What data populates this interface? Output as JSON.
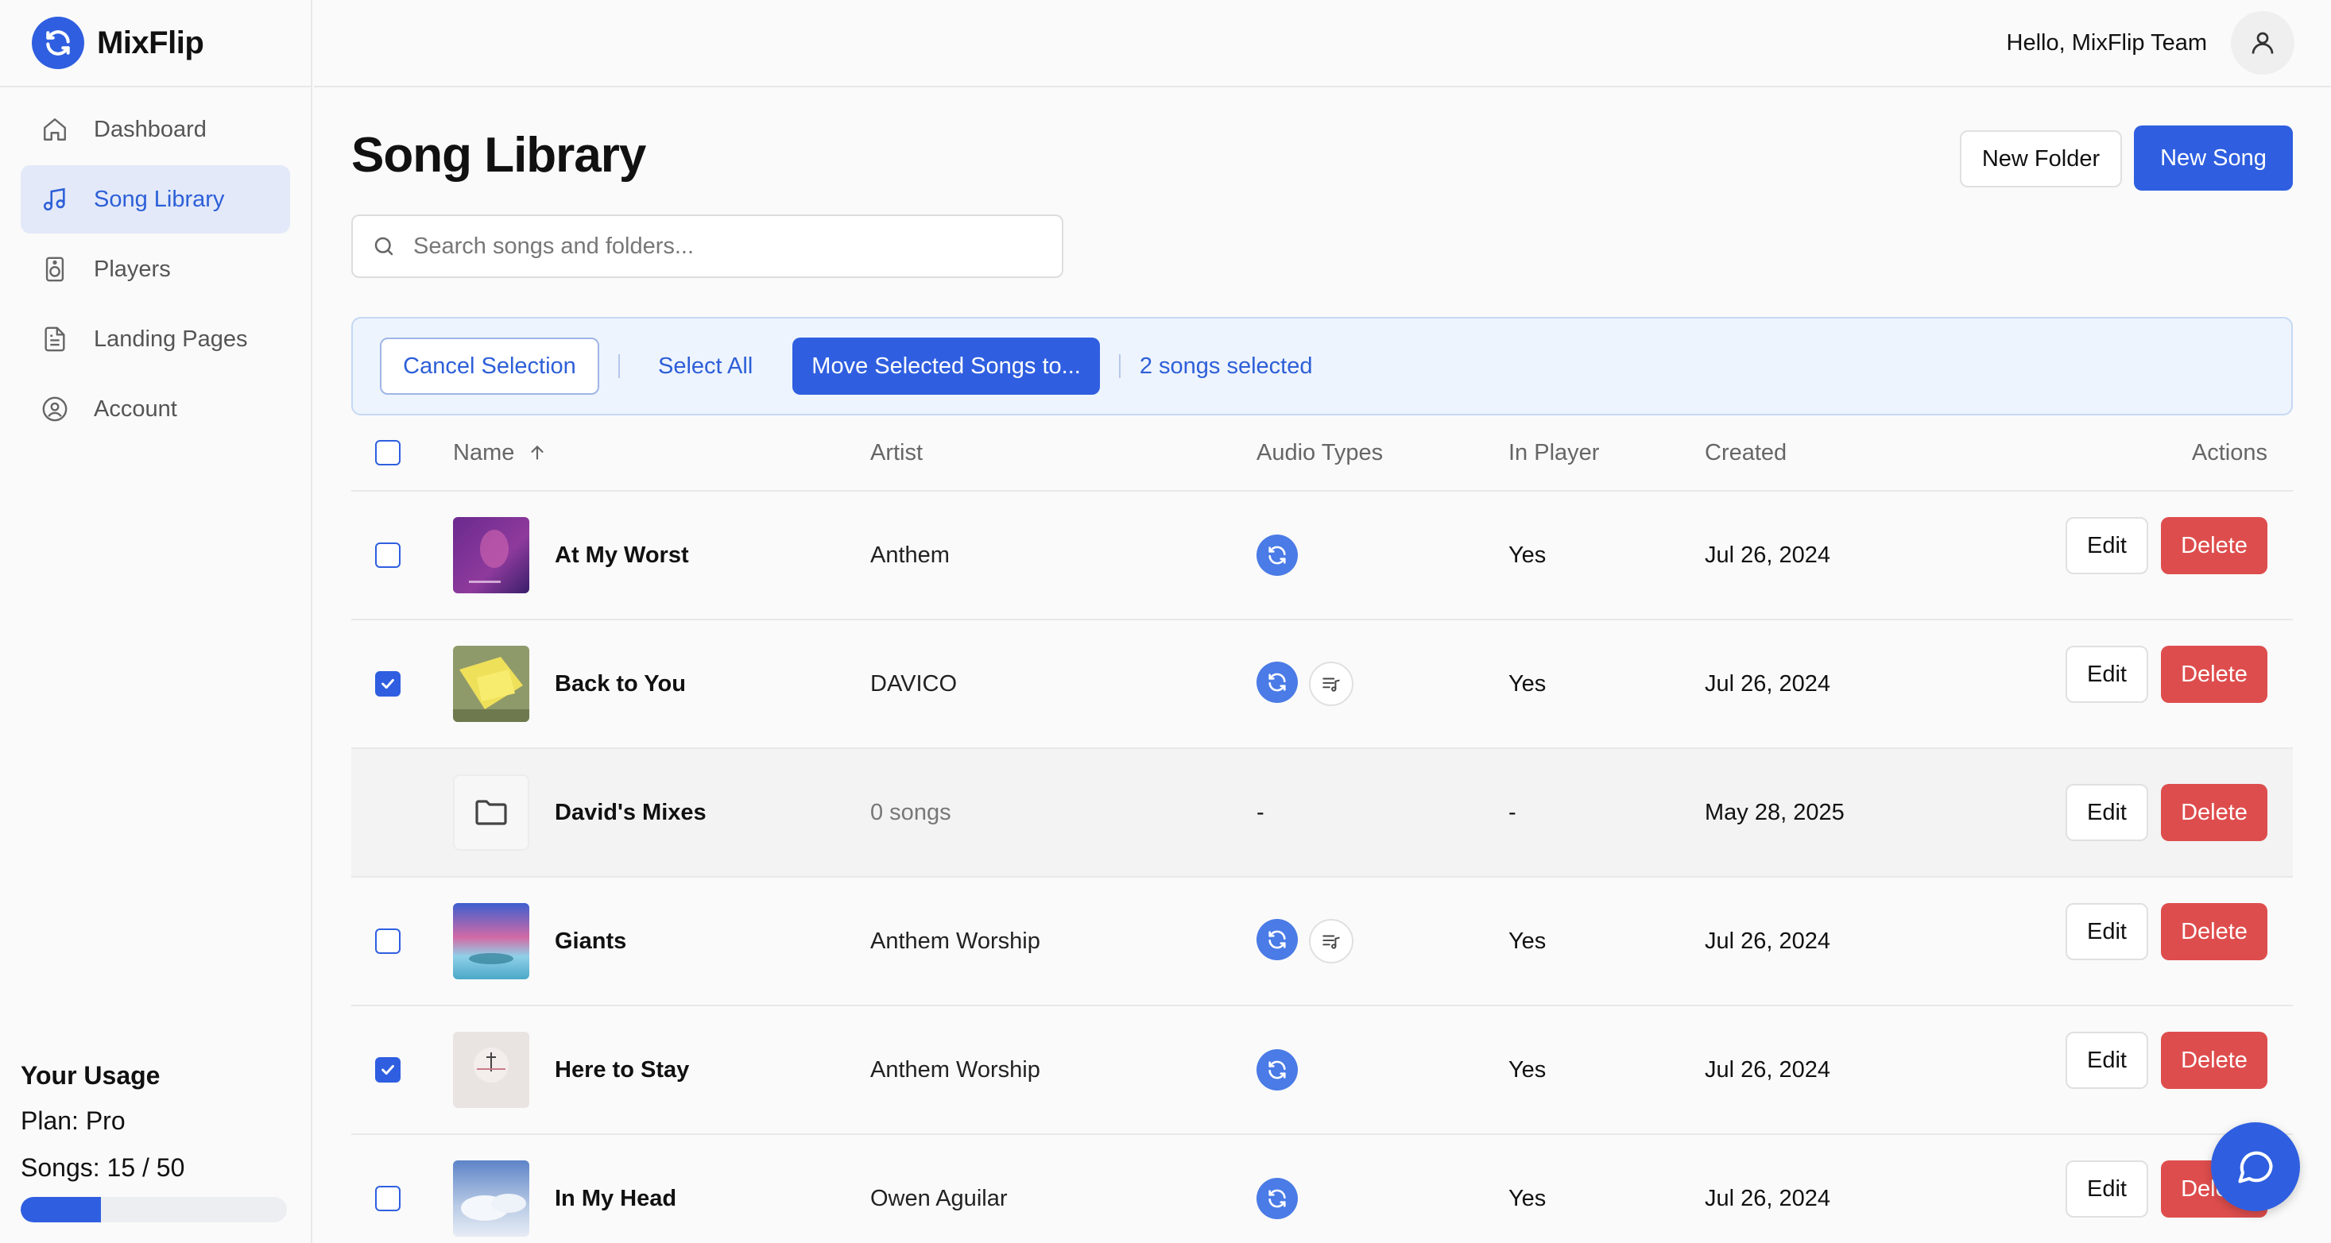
{
  "brand": {
    "name": "MixFlip",
    "logo_icon": "sync-icon",
    "accent": "#2f5fe0"
  },
  "header": {
    "greeting": "Hello, MixFlip Team",
    "avatar_icon": "user-icon"
  },
  "sidebar": {
    "items": [
      {
        "label": "Dashboard",
        "icon": "home-icon",
        "active": false
      },
      {
        "label": "Song Library",
        "icon": "music-note-icon",
        "active": true
      },
      {
        "label": "Players",
        "icon": "speaker-icon",
        "active": false
      },
      {
        "label": "Landing Pages",
        "icon": "document-icon",
        "active": false
      },
      {
        "label": "Account",
        "icon": "user-circle-icon",
        "active": false
      }
    ],
    "usage": {
      "title": "Your Usage",
      "plan": "Plan: Pro",
      "songs": "Songs: 15 / 50",
      "fraction": 0.3
    }
  },
  "main": {
    "title": "Song Library",
    "new_folder_label": "New Folder",
    "new_song_label": "New Song",
    "search_placeholder": "Search songs and folders...",
    "selection": {
      "cancel_label": "Cancel Selection",
      "select_all_label": "Select All",
      "move_label": "Move Selected Songs to...",
      "count_label": "2 songs selected"
    },
    "columns": {
      "name": "Name",
      "artist": "Artist",
      "audio_types": "Audio Types",
      "in_player": "In Player",
      "created": "Created",
      "actions": "Actions"
    },
    "rows": [
      {
        "type": "song",
        "name": "At My Worst",
        "artist": "Anthem",
        "audio": [
          "sync"
        ],
        "in_player": "Yes",
        "created": "Jul 26, 2024",
        "checked": false
      },
      {
        "type": "song",
        "name": "Back to You",
        "artist": "DAVICO",
        "audio": [
          "sync",
          "list"
        ],
        "in_player": "Yes",
        "created": "Jul 26, 2024",
        "checked": true
      },
      {
        "type": "folder",
        "name": "David's Mixes",
        "artist": "0 songs",
        "audio_text": "-",
        "in_player": "-",
        "created": "May 28, 2025"
      },
      {
        "type": "song",
        "name": "Giants",
        "artist": "Anthem Worship",
        "audio": [
          "sync",
          "list"
        ],
        "in_player": "Yes",
        "created": "Jul 26, 2024",
        "checked": false
      },
      {
        "type": "song",
        "name": "Here to Stay",
        "artist": "Anthem Worship",
        "audio": [
          "sync"
        ],
        "in_player": "Yes",
        "created": "Jul 26, 2024",
        "checked": true
      },
      {
        "type": "song",
        "name": "In My Head",
        "artist": "Owen Aguilar",
        "audio": [
          "sync"
        ],
        "in_player": "Yes",
        "created": "Jul 26, 2024",
        "checked": false
      }
    ],
    "edit_label": "Edit",
    "delete_label": "Delete"
  }
}
